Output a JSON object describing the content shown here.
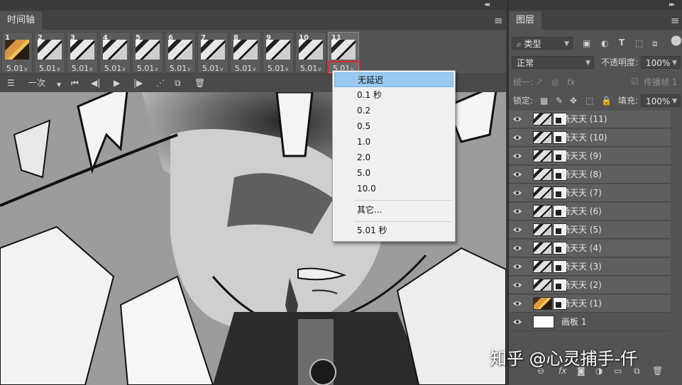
{
  "timeline": {
    "tab_label": "时间轴",
    "frames": [
      {
        "num": "1",
        "delay": "5.01",
        "color": true
      },
      {
        "num": "2",
        "delay": "5.01"
      },
      {
        "num": "3",
        "delay": "5.01"
      },
      {
        "num": "4",
        "delay": "5.01"
      },
      {
        "num": "5",
        "delay": "5.01"
      },
      {
        "num": "6",
        "delay": "5.01"
      },
      {
        "num": "7",
        "delay": "5.01"
      },
      {
        "num": "8",
        "delay": "5.01"
      },
      {
        "num": "9",
        "delay": "5.01"
      },
      {
        "num": "10",
        "delay": "5.01"
      },
      {
        "num": "11",
        "delay": "5.01",
        "selected": true
      }
    ],
    "loop_label": "一次",
    "icons": [
      "convert-icon",
      "first-frame-icon",
      "prev-frame-icon",
      "play-icon",
      "next-frame-icon",
      "tween-icon",
      "new-frame-icon",
      "delete-frame-icon"
    ]
  },
  "delay_menu": {
    "items": [
      "无延迟",
      "0.1 秒",
      "0.2",
      "0.5",
      "1.0",
      "2.0",
      "5.0",
      "10.0"
    ],
    "other": "其它...",
    "current": "5.01 秒",
    "highlighted_index": 0
  },
  "layers_panel": {
    "tab_label": "图层",
    "filter_label": "类型",
    "blend_mode": "正常",
    "opacity_label": "不透明度:",
    "opacity_value": "100%",
    "unify_label": "统一:",
    "propagate_label": "传播帧 1",
    "lock_label": "锁定:",
    "fill_label": "填充:",
    "fill_value": "100%",
    "layers": [
      {
        "name": "杨天天 (11)"
      },
      {
        "name": "杨天天 (10)"
      },
      {
        "name": "杨天天 (9)"
      },
      {
        "name": "杨天天 (8)"
      },
      {
        "name": "杨天天 (7)"
      },
      {
        "name": "杨天天 (6)"
      },
      {
        "name": "杨天天 (5)"
      },
      {
        "name": "杨天天 (4)"
      },
      {
        "name": "杨天天 (3)"
      },
      {
        "name": "杨天天 (2)"
      },
      {
        "name": "杨天天 (1)",
        "color": true
      },
      {
        "name": "画板 1",
        "background": true
      }
    ]
  },
  "watermark": "知乎 @心灵捕手-仟",
  "colors": {
    "panel_bg": "#535353",
    "menu_highlight": "#99c9ef",
    "annotation_red": "#e0262b"
  }
}
